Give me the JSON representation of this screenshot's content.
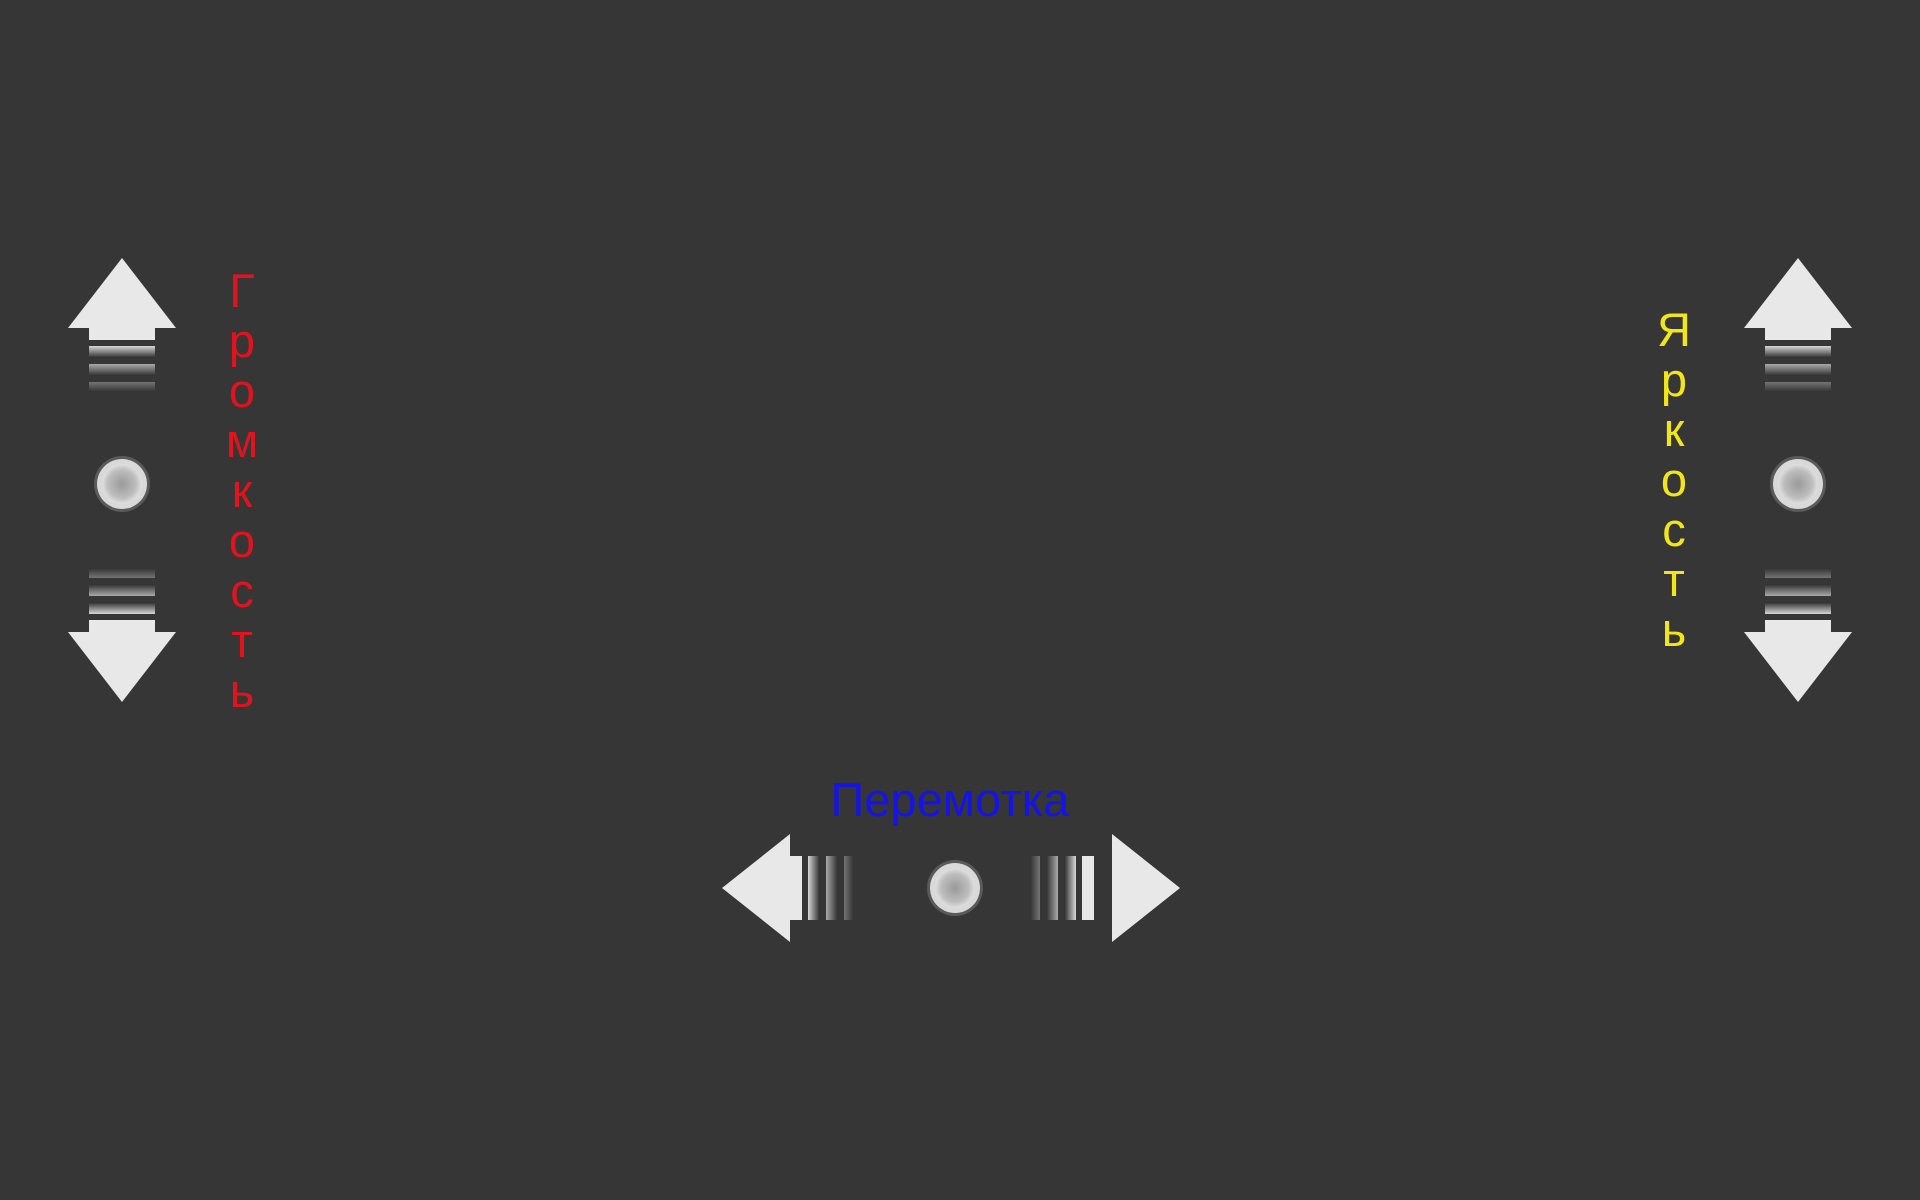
{
  "overlay": {
    "volume": {
      "label": "Громкость",
      "color": "#e0141e",
      "up_icon": "arrow-up-icon",
      "down_icon": "arrow-down-icon",
      "center_icon": "touch-point-icon"
    },
    "brightness": {
      "label": "Яркость",
      "color": "#f2e619",
      "up_icon": "arrow-up-icon",
      "down_icon": "arrow-down-icon",
      "center_icon": "touch-point-icon"
    },
    "seek": {
      "label": "Перемотка",
      "color": "#1414e6",
      "left_icon": "arrow-left-icon",
      "right_icon": "arrow-right-icon",
      "center_icon": "touch-point-icon"
    }
  },
  "colors": {
    "background": "#363636",
    "arrow_fill": "#e8e8e8"
  }
}
